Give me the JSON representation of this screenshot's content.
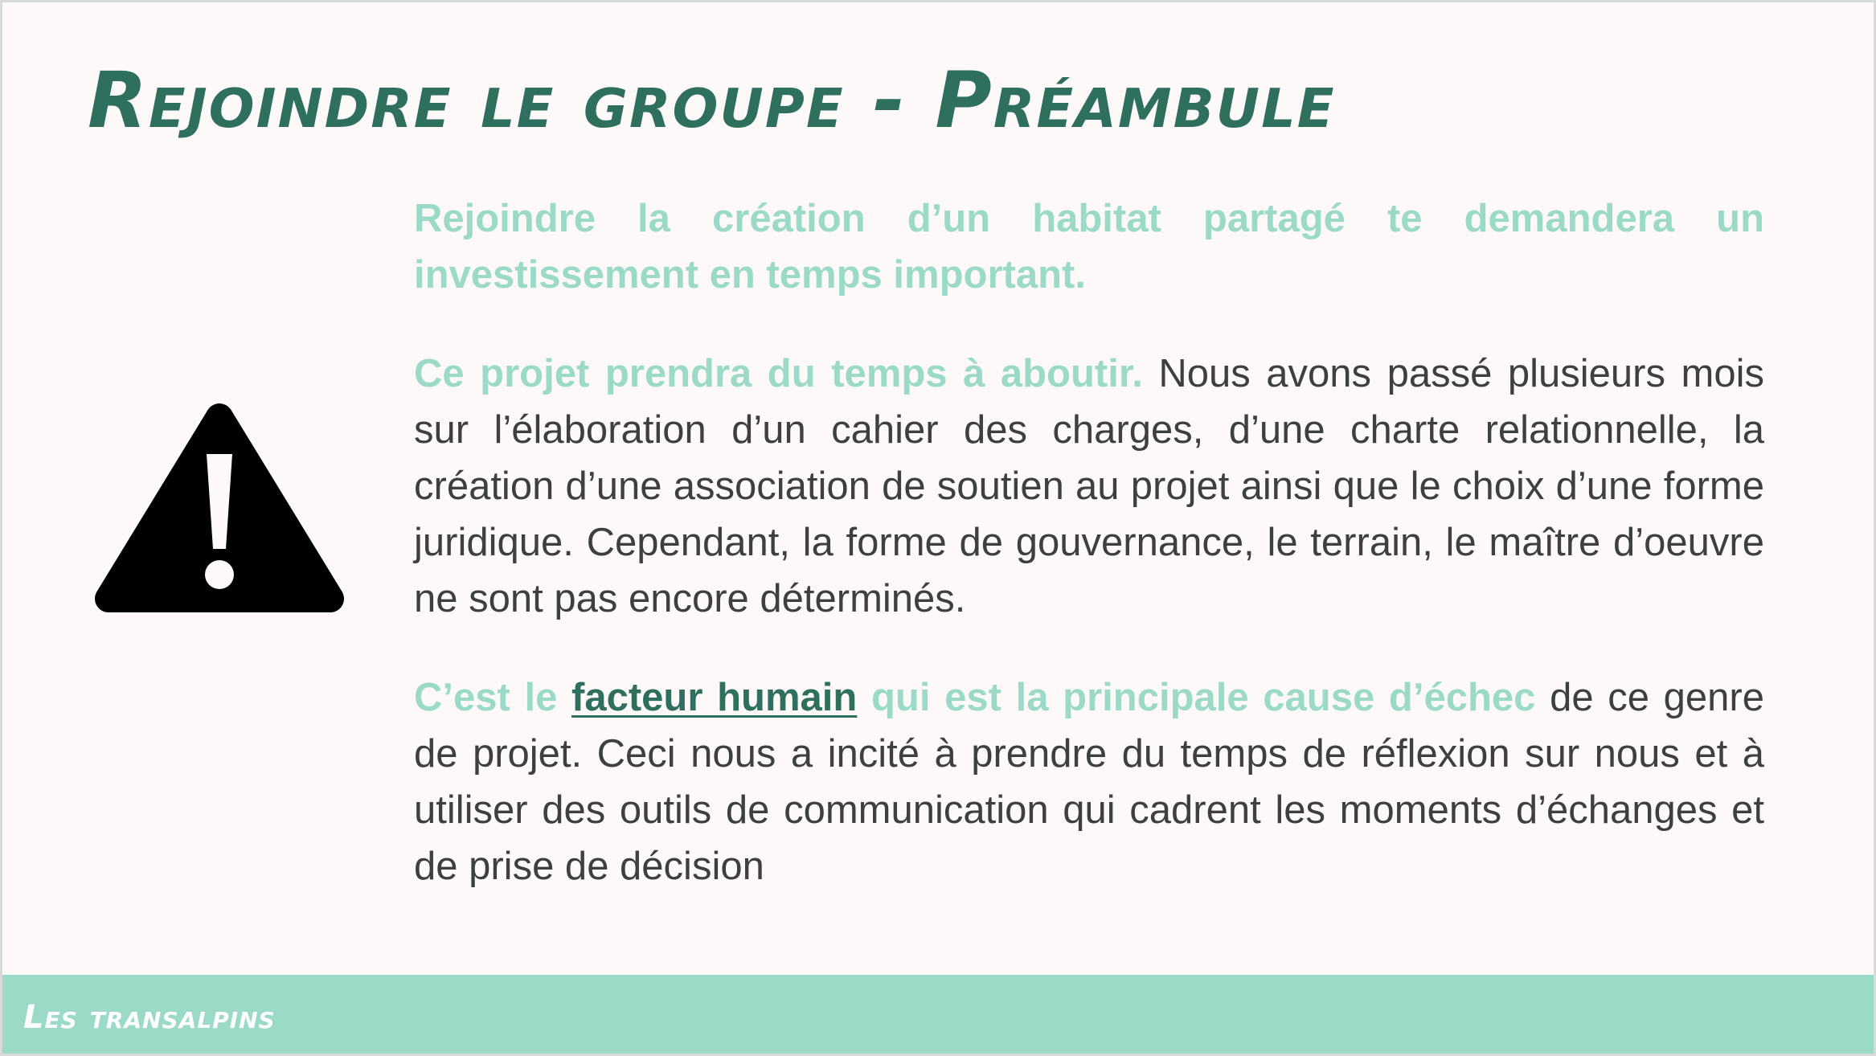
{
  "slide": {
    "title": "Rejoindre le groupe - Préambule"
  },
  "icons": {
    "warning": "warning-triangle-icon"
  },
  "colors": {
    "background": "#fdf9f8",
    "title": "#2f6f5d",
    "highlight": "#9bdac6",
    "body_text": "#3f3f3f",
    "link": "#2f6f5d",
    "footer_bar": "#9bdac6"
  },
  "paragraphs": {
    "p1": {
      "highlight": "Rejoindre la création d’un habitat partagé te demandera un investissement en temps important."
    },
    "p2": {
      "highlight": "Ce projet prendra du temps à aboutir.",
      "text": " Nous avons passé plusieurs mois sur l’élaboration d’un cahier des charges, d’une charte relationnelle, la création d’une association de soutien au projet ainsi que le choix d’une forme juridique. Cependant, la forme de gouvernance, le terrain, le maître d’oeuvre ne sont pas encore déterminés."
    },
    "p3": {
      "highlight_start": "C’est le ",
      "link": "facteur humain",
      "highlight_end": " qui est la principale cause d’échec",
      "text": " de ce genre de projet. Ceci nous a incité à prendre du temps de réflexion sur nous et à utiliser des outils de communication qui cadrent les moments d’échanges et de prise de décision"
    }
  },
  "footer": {
    "label": "Les transalpins"
  }
}
